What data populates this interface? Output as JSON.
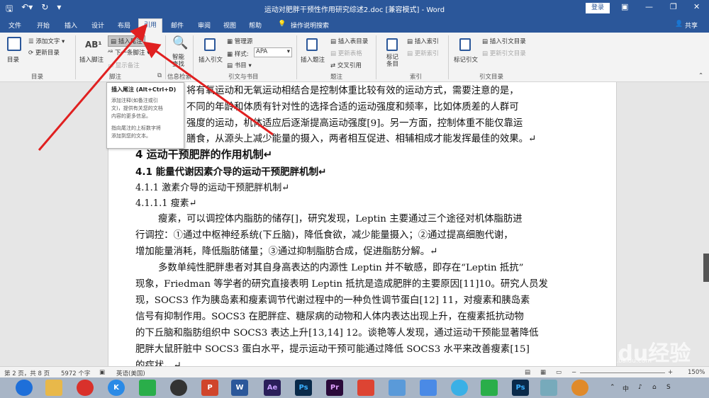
{
  "window": {
    "title": "运动对肥胖干预性作用研究综述2.doc [兼容模式] - Word",
    "login": "登录",
    "share": "共享",
    "accent_color": "#2b579a"
  },
  "tabs": [
    {
      "label": "文件"
    },
    {
      "label": "开始"
    },
    {
      "label": "插入"
    },
    {
      "label": "设计"
    },
    {
      "label": "布局"
    },
    {
      "label": "引用"
    },
    {
      "label": "邮件"
    },
    {
      "label": "审阅"
    },
    {
      "label": "视图"
    },
    {
      "label": "帮助"
    },
    {
      "label": "操作说明搜索"
    }
  ],
  "ribbon": {
    "toc": {
      "label": "目录",
      "add_text": "添加文字",
      "update": "更新目录",
      "group": "目录"
    },
    "footnotes": {
      "insert_footnote": "插入脚注",
      "insert_endnote": "插入尾注",
      "next_footnote": "下一条脚注",
      "show_notes": "显示备注",
      "group": "脚注",
      "ab_glyph": "AB¹"
    },
    "research": {
      "smart_lookup": "智能\n查找",
      "group": "信息检索"
    },
    "citations": {
      "insert_citation": "插入引文",
      "manage_sources": "管理源",
      "style_label": "样式:",
      "style_value": "APA",
      "bibliography": "书目",
      "group": "引文与书目"
    },
    "captions": {
      "insert_caption": "插入题注",
      "insert_table_of_figures": "插入表目录",
      "update_table": "更新表格",
      "cross_reference": "交叉引用",
      "group": "题注"
    },
    "index": {
      "mark_entry": "标记\n条目",
      "insert_index": "插入索引",
      "update_index": "更新索引",
      "group": "索引"
    },
    "authorities": {
      "mark_citation": "标记引文",
      "insert_table": "插入引文目录",
      "update_table": "更新引文目录",
      "group": "引文目录"
    }
  },
  "tooltip": {
    "title": "插入尾注 (Alt+Ctrl+D)",
    "line1": "添加注释(如备注或引",
    "line2": "文)，提供有关您的文档",
    "line3": "内容的更多信息。",
    "line4": "指向尾注的上标数字将",
    "line5": "添加到您的文本。"
  },
  "document": {
    "lines": [
      "将有氧运动和无氧运动相结合是控制体重比较有效的运动方式，需要注意的是，",
      "不同的年龄和体质有针对性的选择合适的运动强度和频率，比如体质差的人群可",
      "强度的运动，机体适应后逐渐提高运动强度[9]。另一方面，控制体重不能仅靠运",
      "膳食，从源头上减少能量的摄入，两者相互促进、相辅相成才能发挥最佳的效果。↵"
    ],
    "h_section": "4  运动干预肥胖的作用机制↵",
    "h_sub": "4.1  能量代谢因素介导的运动干预肥胖机制↵",
    "h_subsub": "4.1.1  激素介导的运动干预肥胖机制↵",
    "h_4": "4.1.1.1  瘦素↵",
    "para1": [
      "瘦素，可以调控体内脂肪的储存[]，研究发现，Leptin 主要通过三个途径对机体脂肪进",
      "行调控：①通过中枢神经系统(下丘脑)，降低食欲，减少能量摄入；②通过提高细胞代谢，",
      "增加能量消耗，降低脂肪储量；③通过抑制脂肪合成，促进脂肪分解。↵"
    ],
    "para2": [
      "多数单纯性肥胖患者对其自身高表达的内源性 Leptin 并不敏感，即存在“Leptin 抵抗”",
      "现象，Friedman 等学者的研究直接表明 Leptin 抵抗是造成肥胖的主要原因[11]10。研究人员发",
      "现，SOCS3 作为胰岛素和瘦素调节代谢过程中的一种负性调节蛋白[12] 11，对瘦素和胰岛素",
      "信号有抑制作用。SOCS3 在肥胖症、糖尿病的动物和人体内表达出现上升，在瘦素抵抗动物",
      "的下丘脑和脂肪组织中 SOCS3 表达上升[13,14] 12。谈艳等人发现，通过运动干预能显著降低",
      "肥胖大鼠肝脏中 SOCS3 蛋白水平，提示运动干预可能通过降低 SOCS3 水平来改善瘦素[15]",
      "的症状。↵"
    ]
  },
  "status": {
    "page": "第 2 页，共 8 页",
    "words": "5972 个字",
    "lang": "英语(美国)",
    "zoom": "150%"
  },
  "watermark": {
    "text": "Baidu经验",
    "sub": "jingyan.baidu.com"
  },
  "taskbar": {
    "apps": [
      "browser",
      "files",
      "netease",
      "kugou",
      "wechat",
      "qq",
      "powerpoint",
      "word",
      "aftereffects",
      "photoshop",
      "premiere",
      "ps2",
      "wps",
      "finder",
      "feishu",
      "baidu-netdisk",
      "evernote",
      "photoshop3",
      "notes",
      "chrome"
    ],
    "tray": "中"
  }
}
